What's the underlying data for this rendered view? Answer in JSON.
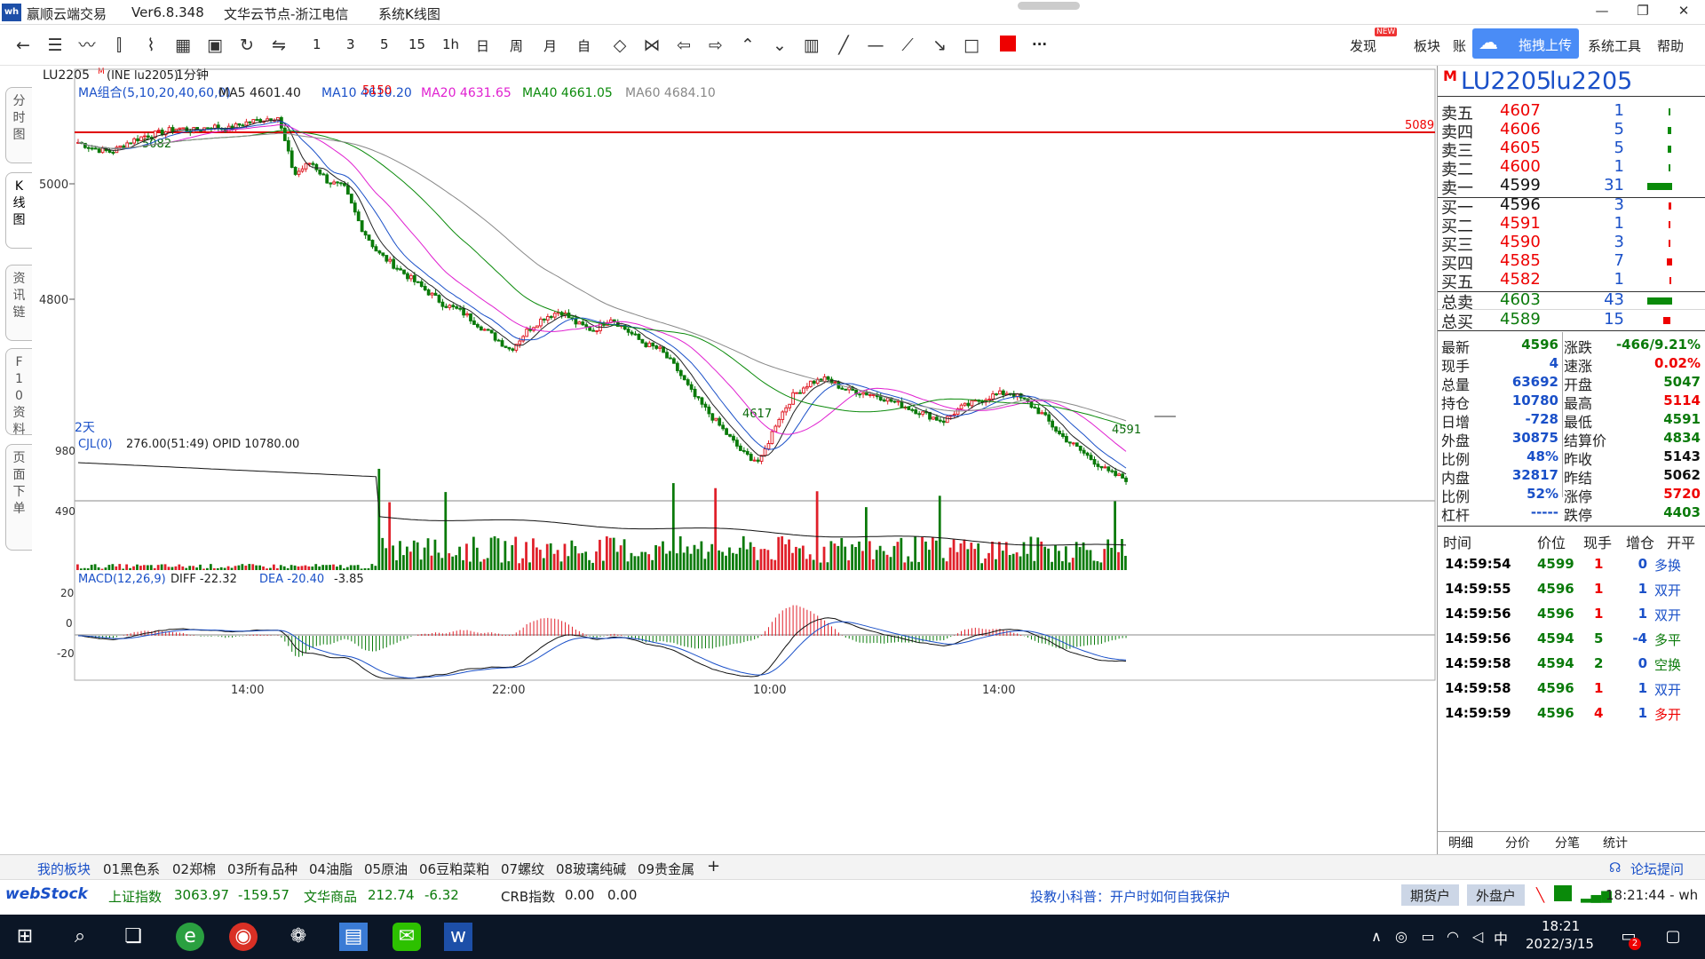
{
  "window": {
    "logo": "wh",
    "title": "赢顺云端交易",
    "version": "Ver6.8.348",
    "node": "文华云节点-浙江电信",
    "view": "系统K线图",
    "min": "—",
    "max": "❐",
    "close": "✕"
  },
  "toolbar": {
    "periods": [
      "1",
      "3",
      "5",
      "15",
      "1h",
      "日",
      "周",
      "月",
      "自"
    ],
    "more": "···",
    "new_badge": "NEW",
    "discover": "发现",
    "sector": "板块",
    "account": "账",
    "upload": "拖拽上传",
    "tools": "系统工具",
    "help": "帮助",
    "red_square_color": "#e60000"
  },
  "leftbar": {
    "tabs": [
      "分时图",
      "K线图",
      "资讯链",
      "F10资料",
      "页面下单"
    ]
  },
  "chart": {
    "contract_label": "LU2205",
    "contract_sup": "M",
    "contract_detail": "(INE lu2205)",
    "period_select": "1分钟",
    "ma_group": "MA组合(5,10,20,40,60,0)",
    "ma5": "MA5 4601.40",
    "ma10": "MA10 4610.20",
    "ma20": "MA20 4631.65",
    "ma40": "MA40 4661.05",
    "ma60": "MA60 4684.10",
    "price_ticks": [
      "5000",
      "4800"
    ],
    "high_label": "5150",
    "low_label_1": "5082",
    "low_label_2": "4617",
    "last_low": "4591",
    "line_label": "5089",
    "days_label": "2天",
    "cjl_header": "CJL(0)",
    "cjl_values": "276.00(51:49)  OPID 10780.00",
    "vol_ticks": [
      "980",
      "490"
    ],
    "macd_header": "MACD(12,26,9)",
    "diff": "DIFF -22.32",
    "dea": "DEA -20.40",
    "macd_val": "-3.85",
    "macd_ticks": [
      "20",
      "0",
      "-20"
    ],
    "time_ticks": [
      "14:00",
      "22:00",
      "10:00",
      "14:00"
    ],
    "colors": {
      "up": "#e0202a",
      "down": "#0a7a0a",
      "ma5": "#222222",
      "ma10": "#1a50c8",
      "ma20": "#e020d0",
      "ma40": "#0a8a0a",
      "ma60": "#888888",
      "hline": "#e00000"
    }
  },
  "chart_data": {
    "type": "candlestick",
    "price_range": [
      4560,
      5220
    ],
    "price_series": [
      5110,
      5100,
      5095,
      5110,
      5120,
      5125,
      5132,
      5128,
      5135,
      5130,
      5140,
      5145,
      5150,
      5060,
      5080,
      5050,
      5040,
      4980,
      4940,
      4920,
      4900,
      4880,
      4860,
      4850,
      4830,
      4810,
      4790,
      4820,
      4840,
      4850,
      4830,
      4820,
      4840,
      4820,
      4800,
      4790,
      4760,
      4720,
      4690,
      4660,
      4630,
      4617,
      4680,
      4720,
      4740,
      4745,
      4730,
      4725,
      4720,
      4710,
      4700,
      4690,
      4680,
      4700,
      4710,
      4720,
      4725,
      4710,
      4690,
      4660,
      4640,
      4620,
      4600,
      4591
    ],
    "hline_value": 5089,
    "volume_range": [
      0,
      1100
    ],
    "macd_range": [
      -40,
      40
    ]
  },
  "quote": {
    "market": "M",
    "code_upper": "LU2205",
    "code_lower": "lu2205",
    "asks": [
      {
        "label": "卖五",
        "price": "4607",
        "vol": "1"
      },
      {
        "label": "卖四",
        "price": "4606",
        "vol": "5"
      },
      {
        "label": "卖三",
        "price": "4605",
        "vol": "5"
      },
      {
        "label": "卖二",
        "price": "4600",
        "vol": "1"
      },
      {
        "label": "卖一",
        "price": "4599",
        "vol": "31"
      }
    ],
    "bids": [
      {
        "label": "买一",
        "price": "4596",
        "vol": "3"
      },
      {
        "label": "买二",
        "price": "4591",
        "vol": "1"
      },
      {
        "label": "买三",
        "price": "4590",
        "vol": "3"
      },
      {
        "label": "买四",
        "price": "4585",
        "vol": "7"
      },
      {
        "label": "买五",
        "price": "4582",
        "vol": "1"
      }
    ],
    "totals": [
      {
        "label": "总卖",
        "price": "4603",
        "vol": "43"
      },
      {
        "label": "总买",
        "price": "4589",
        "vol": "15"
      }
    ],
    "stats": [
      {
        "l1": "最新",
        "v1": "4596",
        "l2": "涨跌",
        "v2": "-466/9.21%"
      },
      {
        "l1": "现手",
        "v1": "4",
        "l2": "速涨",
        "v2": "0.02%"
      },
      {
        "l1": "总量",
        "v1": "63692",
        "l2": "开盘",
        "v2": "5047"
      },
      {
        "l1": "持仓",
        "v1": "10780",
        "l2": "最高",
        "v2": "5114"
      },
      {
        "l1": "日增",
        "v1": "-728",
        "l2": "最低",
        "v2": "4591"
      },
      {
        "l1": "外盘",
        "v1": "30875",
        "l2": "结算价",
        "v2": "4834"
      },
      {
        "l1": "比例",
        "v1": "48%",
        "l2": "昨收",
        "v2": "5143"
      },
      {
        "l1": "内盘",
        "v1": "32817",
        "l2": "昨结",
        "v2": "5062"
      },
      {
        "l1": "比例",
        "v1": "52%",
        "l2": "涨停",
        "v2": "5720"
      },
      {
        "l1": "杠杆",
        "v1": "-----",
        "l2": "跌停",
        "v2": "4403"
      }
    ],
    "tick_header": [
      "时间",
      "价位",
      "现手",
      "增仓",
      "开平"
    ],
    "ticks": [
      {
        "time": "14:59:54",
        "price": "4599",
        "hand": "1",
        "delta": "0",
        "type": "多换"
      },
      {
        "time": "14:59:55",
        "price": "4596",
        "hand": "1",
        "delta": "1",
        "type": "双开"
      },
      {
        "time": "14:59:56",
        "price": "4596",
        "hand": "1",
        "delta": "1",
        "type": "双开"
      },
      {
        "time": "14:59:56",
        "price": "4594",
        "hand": "5",
        "delta": "-4",
        "type": "多平"
      },
      {
        "time": "14:59:58",
        "price": "4594",
        "hand": "2",
        "delta": "0",
        "type": "空换"
      },
      {
        "time": "14:59:58",
        "price": "4596",
        "hand": "1",
        "delta": "1",
        "type": "双开"
      },
      {
        "time": "14:59:59",
        "price": "4596",
        "hand": "4",
        "delta": "1",
        "type": "多开"
      }
    ],
    "tabs": [
      "明细",
      "分价",
      "分笔",
      "统计"
    ]
  },
  "blocks": {
    "items": [
      "我的板块",
      "01黑色系",
      "02郑棉",
      "03所有品种",
      "04油脂",
      "05原油",
      "06豆粕菜粕",
      "07螺纹",
      "08玻璃纯碱",
      "09贵金属"
    ],
    "add": "+",
    "forum": "论坛提问"
  },
  "status": {
    "brand": "webStock",
    "sh_label": "上证指数",
    "sh_value": "3063.97",
    "sh_change": "-159.57",
    "wh_label": "文华商品",
    "wh_value": "212.74",
    "wh_change": "-6.32",
    "crb_label": "CRB指数",
    "crb_value": "0.00",
    "crb_change": "0.00",
    "news": "投教小科普：开户时如何自我保护",
    "futures_account": "期货户",
    "forex_account": "外盘户",
    "clock": "18:21:44 - wh"
  },
  "taskbar": {
    "time": "18:21",
    "date": "2022/3/15",
    "ime": "中",
    "notif": "2"
  }
}
